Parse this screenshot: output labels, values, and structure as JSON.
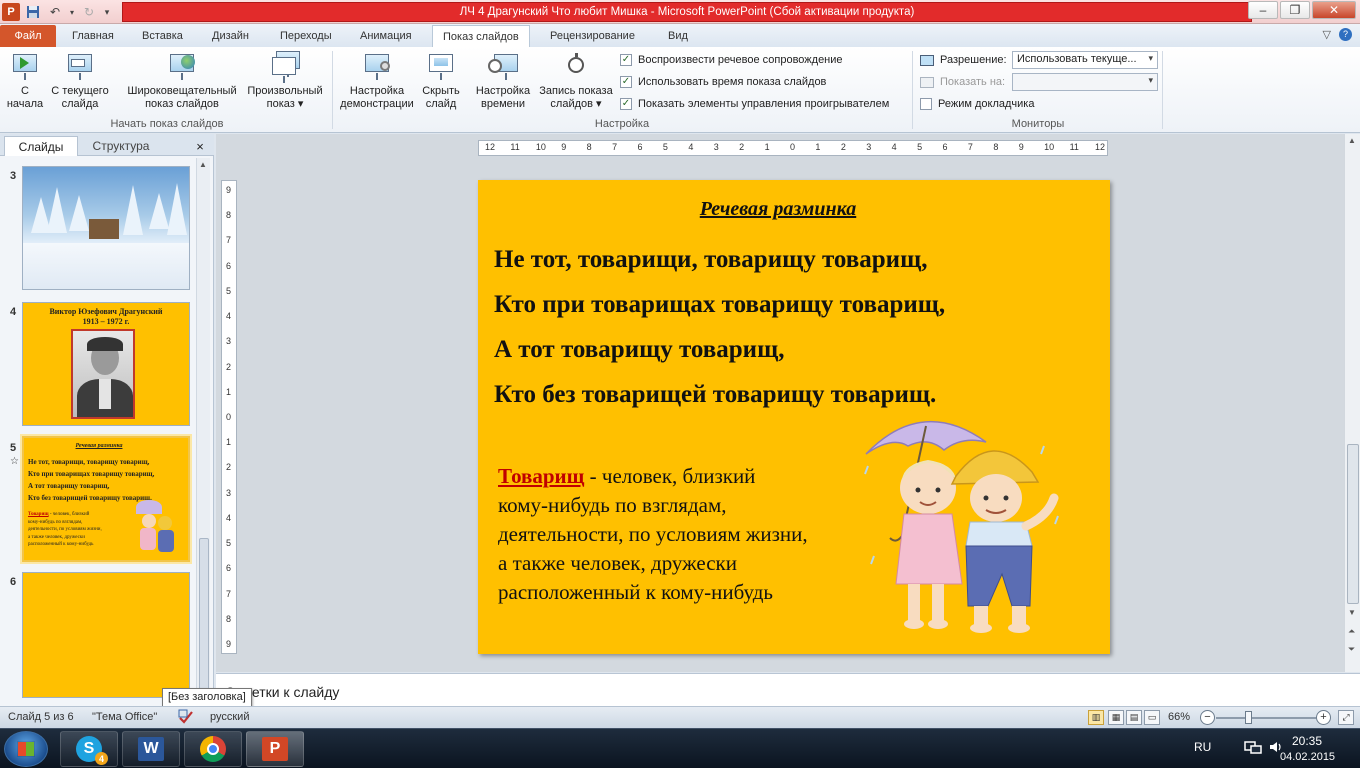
{
  "titlebar": {
    "title": "ЛЧ 4 Драгунский Что любит Мишка  -  Microsoft PowerPoint (Сбой активации продукта)",
    "logo_letter": "P"
  },
  "tabs": {
    "file": "Файл",
    "items": [
      "Главная",
      "Вставка",
      "Дизайн",
      "Переходы",
      "Анимация",
      "Показ слайдов",
      "Рецензирование",
      "Вид"
    ],
    "active": "Показ слайдов"
  },
  "ribbon": {
    "start_group": {
      "label": "Начать показ слайдов",
      "btn_from_start": [
        "С",
        "начала"
      ],
      "btn_from_current": [
        "С текущего",
        "слайда"
      ],
      "btn_broadcast": [
        "Широковещательный",
        "показ слайдов"
      ],
      "btn_custom": [
        "Произвольный",
        "показ ▾"
      ]
    },
    "setup_group": {
      "label": "Настройка",
      "btn_setup": [
        "Настройка",
        "демонстрации"
      ],
      "btn_hide": [
        "Скрыть",
        "слайд"
      ],
      "btn_rehearse": [
        "Настройка",
        "времени"
      ],
      "btn_record": [
        "Запись показа",
        "слайдов ▾"
      ],
      "chk_narration": "Воспроизвести речевое сопровождение",
      "chk_timings": "Использовать время показа слайдов",
      "chk_controls": "Показать элементы управления проигрывателем"
    },
    "monitors_group": {
      "label": "Мониторы",
      "resolution_label": "Разрешение:",
      "resolution_value": "Использовать текуще...",
      "showon_label": "Показать на:",
      "presenter_label": "Режим докладчика"
    }
  },
  "panel": {
    "tab_slides": "Слайды",
    "tab_outline": "Структура",
    "close": "×",
    "thumbs": [
      {
        "num": "3"
      },
      {
        "num": "4",
        "title": "Виктор Юзефович Драгунский",
        "years": "1913 – 1972 г."
      },
      {
        "num": "5",
        "star": "☆",
        "title": "Речевая разминка",
        "lines": [
          "Не тот, товарищи, товарищу товарищ,",
          "Кто при товарищах товарищу товарищ,",
          "А тот товарищу товарищ,",
          "Кто без товарищей товарищу товарищ."
        ],
        "term": "Товарищ",
        "def_lines": [
          " - человек, близкий",
          "кому-нибудь по взглядам,",
          "деятельности, по условиям жизни,",
          "а также человек, дружески",
          "расположенный к кому-нибудь"
        ]
      },
      {
        "num": "6"
      }
    ]
  },
  "ruler": {
    "h": [
      "12",
      "11",
      "10",
      "9",
      "8",
      "7",
      "6",
      "5",
      "4",
      "3",
      "2",
      "1",
      "0",
      "1",
      "2",
      "3",
      "4",
      "5",
      "6",
      "7",
      "8",
      "9",
      "10",
      "11",
      "12"
    ],
    "v": [
      "9",
      "8",
      "7",
      "6",
      "5",
      "4",
      "3",
      "2",
      "1",
      "0",
      "1",
      "2",
      "3",
      "4",
      "5",
      "6",
      "7",
      "8",
      "9"
    ]
  },
  "slide": {
    "title": "Речевая разминка",
    "lines": [
      "Не тот, товарищи, товарищу товарищ,",
      "Кто при товарищах товарищу товарищ,",
      "А тот товарищу товарищ,",
      "Кто без товарищей товарищу товарищ."
    ],
    "term": "Товарищ",
    "definition_lines": [
      " - человек, близкий",
      "кому-нибудь по взглядам,",
      "деятельности, по условиям жизни,",
      "а также человек, дружески",
      "расположенный к кому-нибудь"
    ],
    "bg_color": "#ffc000"
  },
  "notes": {
    "placeholder": "Заметки к слайду",
    "tooltip": "[Без заголовка]"
  },
  "status": {
    "slide_of": "Слайд 5 из 6",
    "theme": "\"Тема Office\"",
    "language": "русский",
    "zoom": "66%",
    "zoom_fraction": 0.33
  },
  "taskbar": {
    "lang": "RU",
    "time": "20:35",
    "date": "04.02.2015",
    "skype_badge": "4"
  }
}
